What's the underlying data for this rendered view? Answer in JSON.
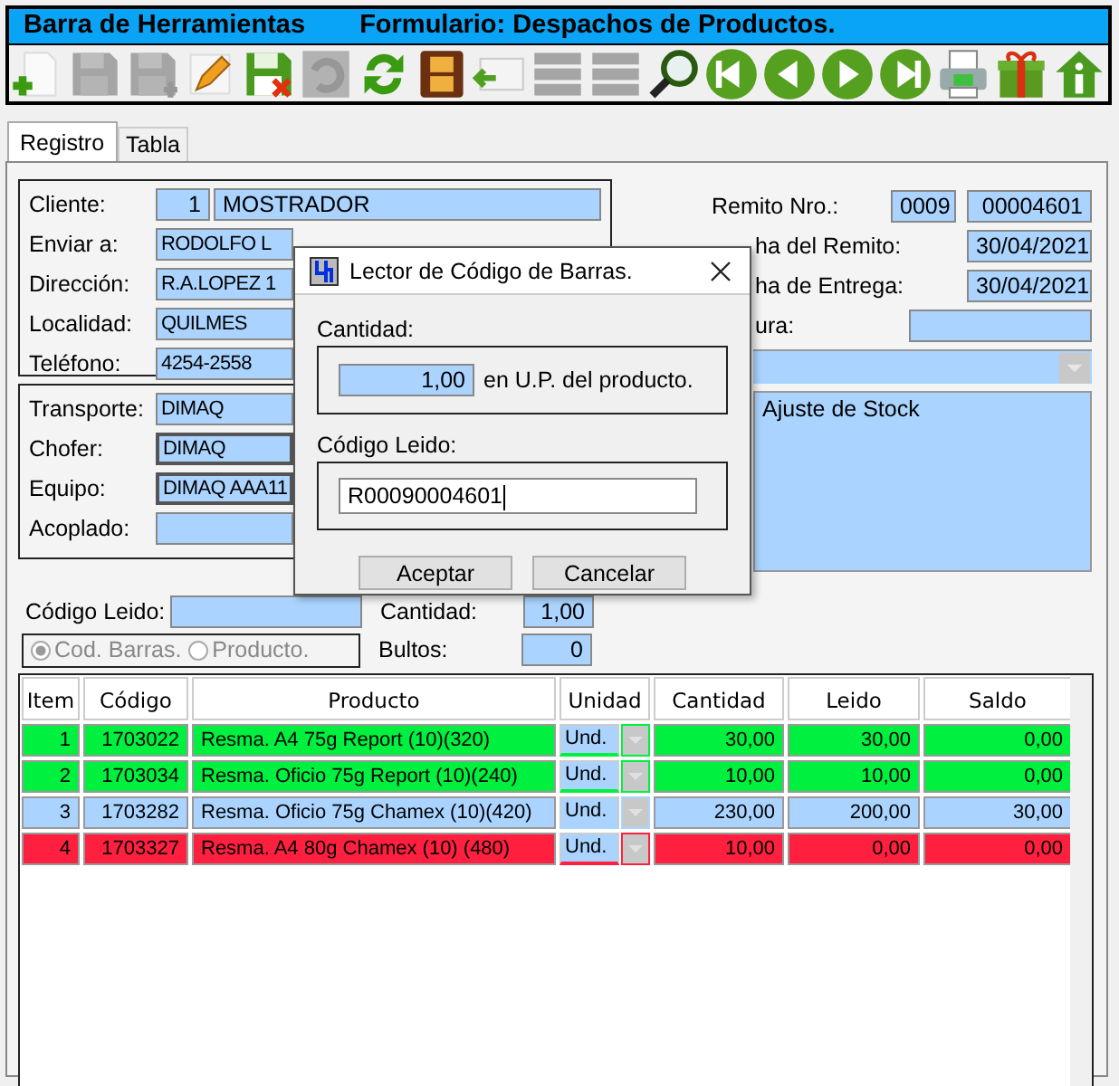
{
  "toolbar": {
    "title": "Barra de Herramientas",
    "form_title": "Formulario: Despachos de Productos.",
    "buttons": [
      {
        "kind": "new",
        "disabled": false
      },
      {
        "kind": "save",
        "disabled": true
      },
      {
        "kind": "saveas",
        "disabled": true
      },
      {
        "kind": "edit",
        "disabled": false
      },
      {
        "kind": "discard",
        "disabled": false
      },
      {
        "kind": "undo",
        "disabled": true
      },
      {
        "kind": "refresh",
        "disabled": false
      },
      {
        "kind": "film",
        "disabled": false
      },
      {
        "kind": "reply",
        "disabled": false
      },
      {
        "kind": "rows",
        "disabled": true
      },
      {
        "kind": "rows",
        "disabled": true
      },
      {
        "kind": "search",
        "disabled": false
      },
      {
        "kind": "first",
        "disabled": false
      },
      {
        "kind": "prev",
        "disabled": false
      },
      {
        "kind": "next",
        "disabled": false
      },
      {
        "kind": "last",
        "disabled": false
      },
      {
        "kind": "print",
        "disabled": false
      },
      {
        "kind": "gift",
        "disabled": false
      },
      {
        "kind": "home",
        "disabled": false
      }
    ]
  },
  "tabs": [
    {
      "label": "Registro",
      "selected": true
    },
    {
      "label": "Tabla",
      "selected": false
    }
  ],
  "client": [
    {
      "label": "Cliente:",
      "values": [
        "1",
        "MOSTRADOR"
      ]
    },
    {
      "label": "Enviar a:",
      "values": [
        "RODOLFO L"
      ]
    },
    {
      "label": "Dirección:",
      "values": [
        "R.A.LOPEZ 1"
      ]
    },
    {
      "label": "Localidad:",
      "values": [
        "QUILMES"
      ]
    },
    {
      "label": "Teléfono:",
      "values": [
        "4254-2558"
      ]
    }
  ],
  "transport": [
    {
      "label": "Transporte:",
      "value": "DIMAQ"
    },
    {
      "label": "Chofer:",
      "value": "DIMAQ"
    },
    {
      "label": "Equipo:",
      "value": "DIMAQ AAA11"
    },
    {
      "label": "Acoplado:"
    }
  ],
  "remito": [
    {
      "label": "Remito Nro.:",
      "values": [
        "0009",
        "00004601"
      ]
    },
    {
      "label": "ha del Remito:",
      "values": [
        "30/04/2021"
      ]
    },
    {
      "label": "ha de Entrega:",
      "values": [
        "30/04/2021"
      ]
    },
    {
      "label": "ura:"
    }
  ],
  "notes": "Ajuste de Stock",
  "reader": {
    "codigo_label": "Código Leido:",
    "cantidad_label": "Cantidad:",
    "cantidad": "1,00",
    "disabled": true,
    "modes": [
      {
        "label": "Cod. Barras.",
        "selected": true
      },
      {
        "label": "Producto.",
        "selected": false
      }
    ],
    "bultos_label": "Bultos:",
    "bultos": "0"
  },
  "table": {
    "columns": [
      "Item",
      "Código",
      "Producto",
      "Unidad",
      "Cantidad",
      "Leido",
      "Saldo"
    ],
    "rows": [
      {
        "item": "1",
        "codigo": "1703022",
        "producto": "Resma. A4 75g Report (10)(320)",
        "unidad": "Und.",
        "cantidad": "30,00",
        "leido": "30,00",
        "saldo": "0,00",
        "color": "#00f040"
      },
      {
        "item": "2",
        "codigo": "1703034",
        "producto": "Resma. Oficio 75g Report (10)(240)",
        "unidad": "Und.",
        "cantidad": "10,00",
        "leido": "10,00",
        "saldo": "0,00",
        "color": "#00f040"
      },
      {
        "item": "3",
        "codigo": "1703282",
        "producto": "Resma. Oficio 75g Chamex (10)(420)",
        "unidad": "Und.",
        "cantidad": "230,00",
        "leido": "200,00",
        "saldo": "30,00",
        "color": "#aad4ff"
      },
      {
        "item": "4",
        "codigo": "1703327",
        "producto": "Resma. A4 80g Chamex (10) (480)",
        "unidad": "Und.",
        "cantidad": "10,00",
        "leido": "0,00",
        "saldo": "0,00",
        "color": "#ff2040"
      }
    ]
  },
  "dialog": {
    "title": "Lector de Código de Barras.",
    "cantidad_label": "Cantidad:",
    "cantidad": "1,00",
    "unit_text": "en U.P. del producto.",
    "codigo_label": "Código Leido:",
    "codigo": "R00090004601",
    "buttons": [
      "Aceptar",
      "Cancelar"
    ]
  }
}
